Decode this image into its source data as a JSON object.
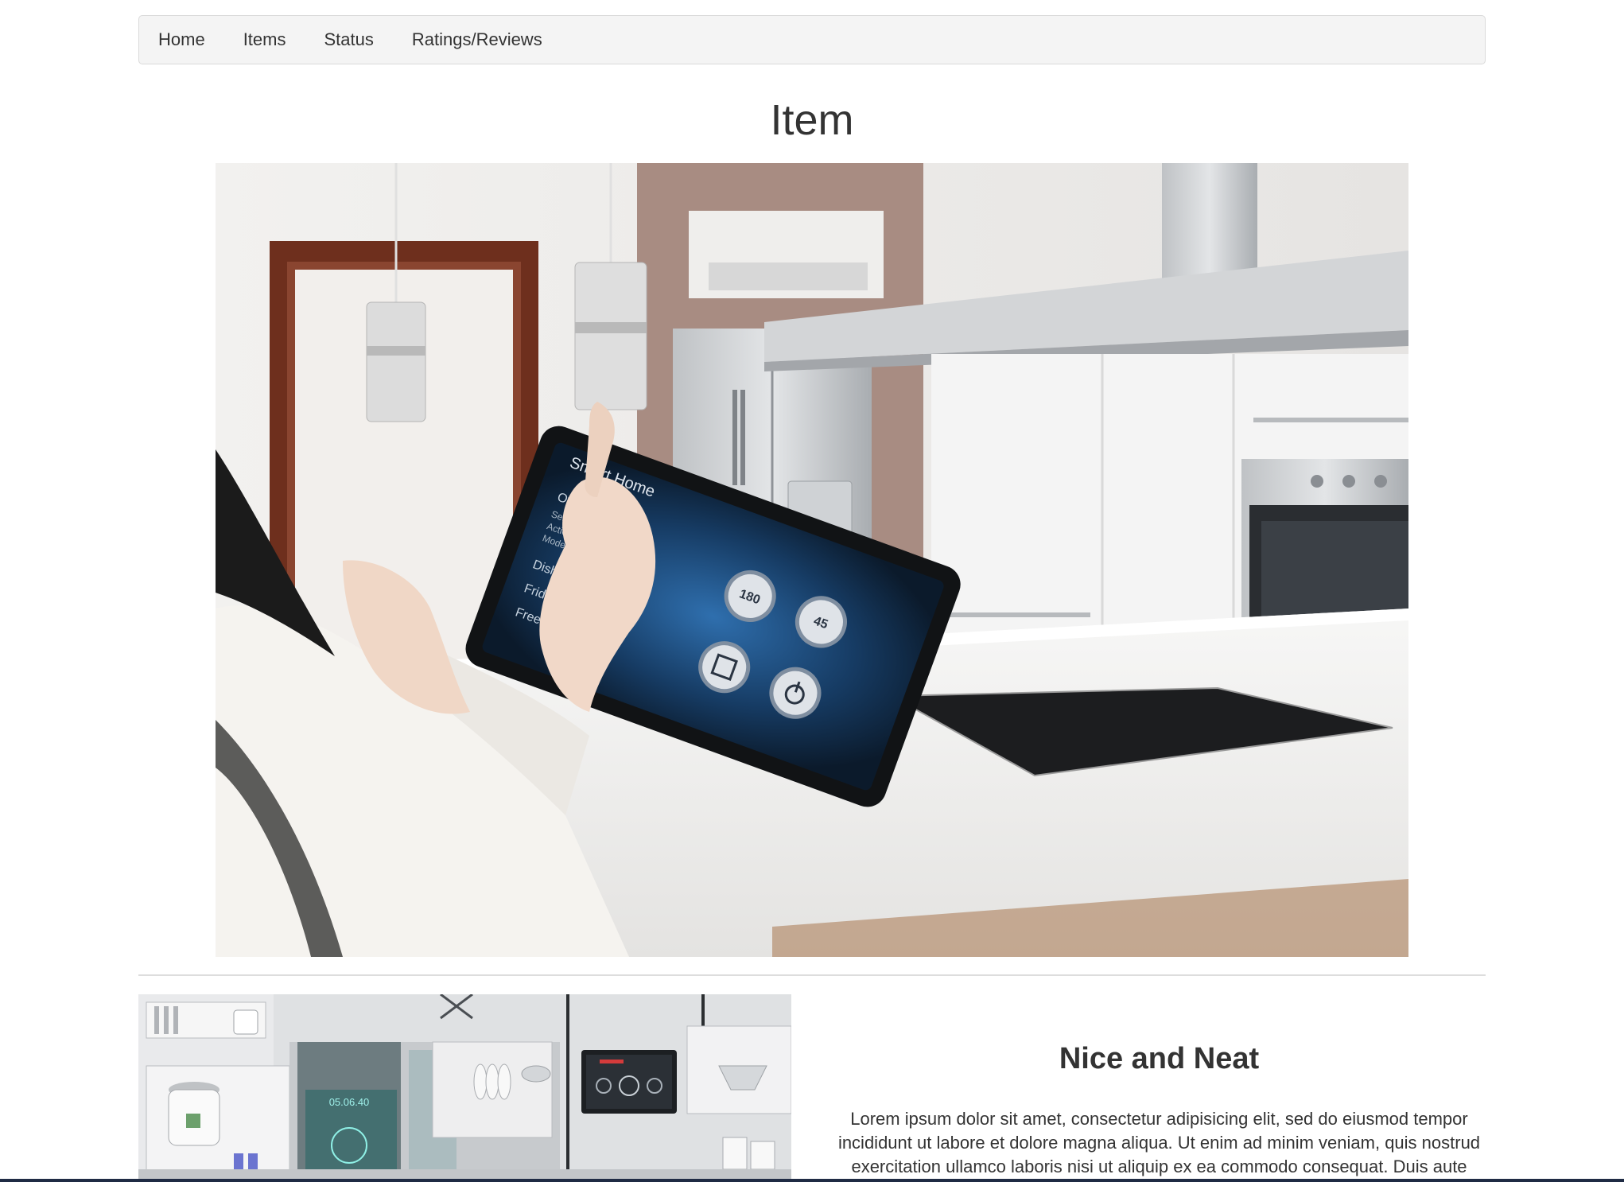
{
  "nav": {
    "items": [
      {
        "label": "Home"
      },
      {
        "label": "Items"
      },
      {
        "label": "Status"
      },
      {
        "label": "Ratings/Reviews"
      }
    ]
  },
  "page": {
    "title": "Item"
  },
  "hero": {
    "tablet": {
      "app_title": "Smart Home",
      "menu": [
        "Oven",
        "Settings",
        "Actions",
        "Mode",
        "Dishwasher",
        "Fridge",
        "Freezer"
      ],
      "dial_1": "180",
      "dial_2": "45"
    }
  },
  "feature": {
    "heading": "Nice and Neat",
    "body": "Lorem ipsum dolor sit amet, consectetur adipisicing elit, sed do eiusmod tempor incididunt ut labore et dolore magna aliqua. Ut enim ad minim veniam, quis nostrud exercitation ullamco laboris nisi ut aliquip ex ea commodo consequat. Duis aute",
    "image": {
      "screen_time": "05.06.40"
    }
  }
}
